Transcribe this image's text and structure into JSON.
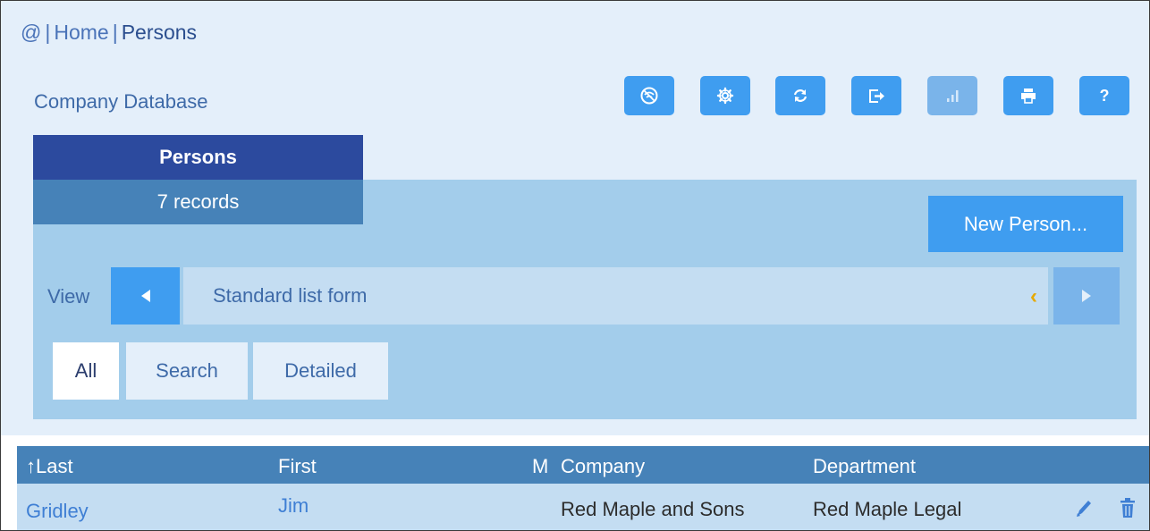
{
  "breadcrumb": {
    "root": "@",
    "separator": "|",
    "home": "Home",
    "current": "Persons"
  },
  "database_title": "Company Database",
  "toolbar": {
    "buttons": [
      {
        "icon": "no-wifi-icon",
        "enabled": true
      },
      {
        "icon": "gear-icon",
        "enabled": true
      },
      {
        "icon": "refresh-icon",
        "enabled": true
      },
      {
        "icon": "export-icon",
        "enabled": true
      },
      {
        "icon": "bar-chart-icon",
        "enabled": false
      },
      {
        "icon": "print-icon",
        "enabled": true
      },
      {
        "icon": "help-icon",
        "label": "?",
        "enabled": true
      }
    ]
  },
  "table_tab": {
    "label": "Persons",
    "count": "7 records"
  },
  "new_button": "New Person...",
  "view": {
    "label": "View",
    "selected": "Standard list form",
    "prev_icon": "triangle-left-icon",
    "next_icon": "triangle-right-icon",
    "chevron": "‹"
  },
  "filter_tabs": [
    {
      "label": "All",
      "active": true
    },
    {
      "label": "Search",
      "active": false
    },
    {
      "label": "Detailed",
      "active": false
    }
  ],
  "table": {
    "columns": {
      "last": "↑Last",
      "first": "First",
      "middle": "M",
      "company": "Company",
      "department": "Department"
    },
    "rows": [
      {
        "last": "Gridley",
        "first": "Jim",
        "middle": "",
        "company": "Red Maple and Sons",
        "department": "Red Maple Legal"
      }
    ]
  },
  "colors": {
    "accent": "#3f9df0",
    "tab_dark": "#2c4a9e",
    "header": "#4682b8",
    "panel": "#a3cdeb",
    "chevron": "#e6a800"
  }
}
